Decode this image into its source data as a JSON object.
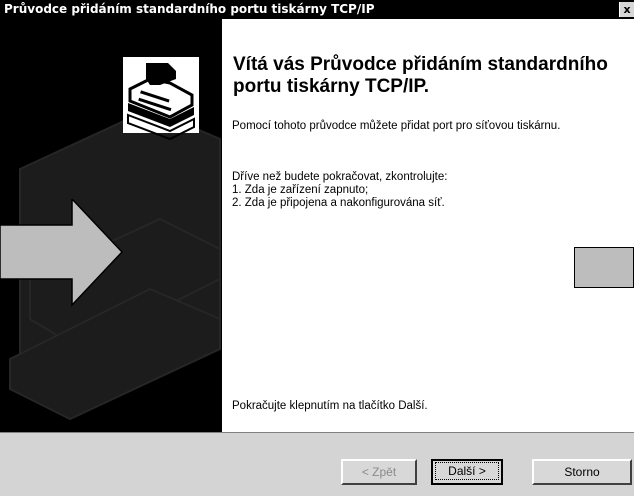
{
  "window": {
    "title": "Průvodce přidáním standardního portu tiskárny TCP/IP",
    "close_glyph": "x"
  },
  "welcome": {
    "heading": "Vítá vás Průvodce přidáním standardního portu tiskárny TCP/IP.",
    "intro": "Pomocí tohoto průvodce můžete přidat port pro síťovou tiskárnu.",
    "check_intro": "Dříve než budete pokračovat, zkontrolujte:",
    "check_items": [
      "1. Zda je zařízení zapnuto;",
      "2. Zda je připojena a nakonfigurována síť."
    ],
    "continue_hint": "Pokračujte klepnutím na tlačítko Další."
  },
  "buttons": {
    "back": "< Zpět",
    "next": "Další >",
    "cancel": "Storno"
  },
  "icons": {
    "wizard_banner": "printer-icon",
    "overlay": "arrow-right-icon"
  },
  "colors": {
    "title_bar": "#000000",
    "left_panel": "#000000",
    "button_face": "#d8d8d8",
    "overlay_arrow": "#bdbdbd"
  }
}
